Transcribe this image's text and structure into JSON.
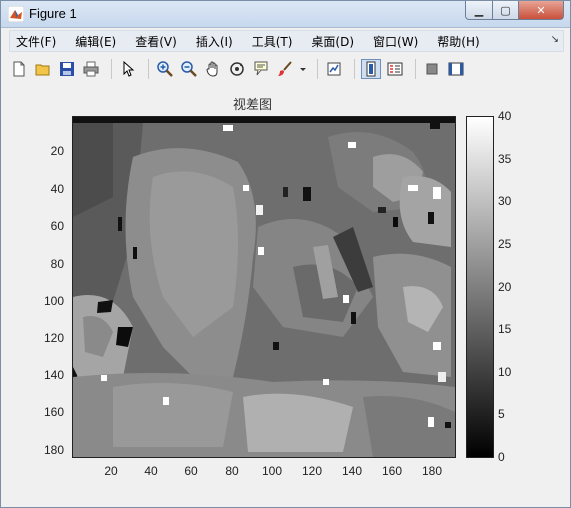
{
  "window": {
    "title": "Figure 1",
    "controls": {
      "minimize": "▁",
      "maximize": "▢",
      "close": "✕"
    }
  },
  "menu": {
    "items": [
      "文件(F)",
      "编辑(E)",
      "查看(V)",
      "插入(I)",
      "工具(T)",
      "桌面(D)",
      "窗口(W)",
      "帮助(H)"
    ]
  },
  "toolbar": {
    "icons": [
      "new-figure-icon",
      "open-file-icon",
      "save-icon",
      "print-icon",
      "pointer-icon",
      "zoom-in-icon",
      "zoom-out-icon",
      "pan-icon",
      "rotate-3d-icon",
      "data-cursor-icon",
      "brush-icon",
      "link-plot-icon",
      "colorbar-icon",
      "legend-icon",
      "hide-plot-tools-icon",
      "show-plot-tools-icon"
    ]
  },
  "plot": {
    "title": "视差图",
    "y_ticks": [
      "20",
      "40",
      "60",
      "80",
      "100",
      "120",
      "140",
      "160",
      "180"
    ],
    "x_ticks": [
      "20",
      "40",
      "60",
      "80",
      "100",
      "120",
      "140",
      "160",
      "180"
    ],
    "colorbar_ticks": [
      "40",
      "35",
      "30",
      "25",
      "20",
      "15",
      "10",
      "5",
      "0"
    ],
    "image_extent": {
      "rows": 183,
      "cols": 190
    },
    "colormap": "gray",
    "colormap_range": [
      0,
      40
    ]
  }
}
